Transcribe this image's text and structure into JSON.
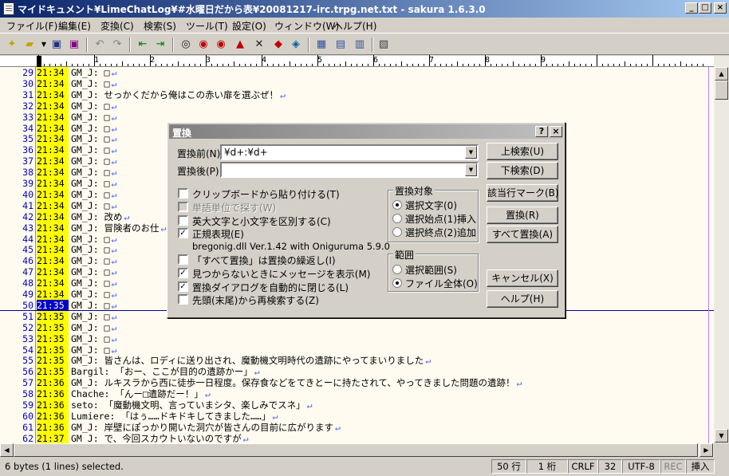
{
  "window": {
    "title": "マイドキュメント¥LimeChatLog¥#水曜日だから表¥20081217-irc.trpg.net.txt - sakura 1.6.3.0"
  },
  "menu": [
    "ファイル(F)",
    "編集(E)",
    "変換(C)",
    "検索(S)",
    "ツール(T)",
    "設定(O)",
    "ウィンドウ(W)",
    "ヘルプ(H)"
  ],
  "ruler": {
    "marks": [
      "1",
      "2",
      "3",
      "4",
      "5",
      "6",
      "7",
      "8",
      "9"
    ]
  },
  "editor": {
    "lines": [
      {
        "n": "29",
        "t": "21:34",
        "s": "GM_J: □"
      },
      {
        "n": "30",
        "t": "21:34",
        "s": "GM_J: □"
      },
      {
        "n": "31",
        "t": "21:34",
        "s": "GM_J: せっかくだから俺はこの赤い扉を選ぶぜ！"
      },
      {
        "n": "32",
        "t": "21:34",
        "s": "GM_J: □"
      },
      {
        "n": "33",
        "t": "21:34",
        "s": "GM_J: □"
      },
      {
        "n": "34",
        "t": "21:34",
        "s": "GM_J: □"
      },
      {
        "n": "35",
        "t": "21:34",
        "s": "GM_J: □"
      },
      {
        "n": "36",
        "t": "21:34",
        "s": "GM_J: □"
      },
      {
        "n": "37",
        "t": "21:34",
        "s": "GM_J: □"
      },
      {
        "n": "38",
        "t": "21:34",
        "s": "GM_J: □"
      },
      {
        "n": "39",
        "t": "21:34",
        "s": "GM_J: □"
      },
      {
        "n": "40",
        "t": "21:34",
        "s": "GM_J: □"
      },
      {
        "n": "41",
        "t": "21:34",
        "s": "GM_J: □"
      },
      {
        "n": "42",
        "t": "21:34",
        "s": "GM_J: 改め"
      },
      {
        "n": "43",
        "t": "21:34",
        "s": "GM_J: 冒険者のお仕"
      },
      {
        "n": "44",
        "t": "21:34",
        "s": "GM_J: □"
      },
      {
        "n": "45",
        "t": "21:34",
        "s": "GM_J: □"
      },
      {
        "n": "46",
        "t": "21:34",
        "s": "GM_J: □"
      },
      {
        "n": "47",
        "t": "21:34",
        "s": "GM_J: □"
      },
      {
        "n": "48",
        "t": "21:34",
        "s": "GM_J: □"
      },
      {
        "n": "49",
        "t": "21:34",
        "s": "GM_J: □"
      },
      {
        "n": "50",
        "t": "21:35",
        "s": "GM_J: □"
      },
      {
        "n": "51",
        "t": "21:35",
        "s": "GM_J: □"
      },
      {
        "n": "52",
        "t": "21:35",
        "s": "GM_J: □"
      },
      {
        "n": "53",
        "t": "21:35",
        "s": "GM_J: □"
      },
      {
        "n": "54",
        "t": "21:35",
        "s": "GM_J: □"
      },
      {
        "n": "55",
        "t": "21:35",
        "s": "GM_J: 皆さんは、ロディに送り出され、魔動機文明時代の遺跡にやってまいりました"
      },
      {
        "n": "56",
        "t": "21:35",
        "s": "Bargil: 「おー、ここが目的の遺跡かー」"
      },
      {
        "n": "57",
        "t": "21:36",
        "s": "GM_J: ルキスラから西に徒歩一日程度。保存食などをてきとーに持たされて、やってきました問題の遺跡！"
      },
      {
        "n": "58",
        "t": "21:36",
        "s": "Chache: 「んー□遺跡だー！」"
      },
      {
        "n": "59",
        "t": "21:36",
        "s": "seto: 「魔動機文明、言っていまシタ、楽しみでスネ」"
      },
      {
        "n": "60",
        "t": "21:36",
        "s": "Lumiere: 「はぅ……ドキドキしてきました……」"
      },
      {
        "n": "61",
        "t": "21:36",
        "s": "GM_J: 岸壁にぽっかり開いた洞穴が皆さんの目前に広がります"
      },
      {
        "n": "62",
        "t": "21:37",
        "s": "GM_J: で、今回スカウトいないのですが"
      }
    ],
    "current_line": "50",
    "return_mark": "↵"
  },
  "dialog": {
    "title": "置換",
    "find_label": "置換前(N)",
    "find_value": "¥d+:¥d+",
    "replace_label": "置換後(P)",
    "replace_value": "",
    "options": [
      {
        "label": "クリップボードから貼り付ける(T)",
        "checked": false,
        "disabled": false
      },
      {
        "label": "単語単位で探す(W)",
        "checked": false,
        "disabled": true
      },
      {
        "label": "英大文字と小文字を区別する(C)",
        "checked": false,
        "disabled": false
      },
      {
        "label": "正規表現(E)",
        "checked": true,
        "disabled": false
      }
    ],
    "regex_lib": "bregonig.dll Ver.1.42 with Oniguruma 5.9.0",
    "options2": [
      {
        "label": "「すべて置換」は置換の繰返し(I)",
        "checked": false
      },
      {
        "label": "見つからないときにメッセージを表示(M)",
        "checked": true
      },
      {
        "label": "置換ダイアログを自動的に閉じる(L)",
        "checked": true
      },
      {
        "label": "先頭(末尾)から再検索する(Z)",
        "checked": false
      }
    ],
    "target_group": {
      "title": "置換対象",
      "items": [
        {
          "label": "選択文字(0)",
          "selected": true
        },
        {
          "label": "選択始点(1)挿入",
          "selected": false
        },
        {
          "label": "選択終点(2)追加",
          "selected": false
        }
      ]
    },
    "range_group": {
      "title": "範囲",
      "items": [
        {
          "label": "選択範囲(S)",
          "selected": false
        },
        {
          "label": "ファイル全体(O)",
          "selected": true
        }
      ]
    },
    "buttons": {
      "find_up": "上検索(U)",
      "find_down": "下検索(D)",
      "mark": "該当行マーク(B)",
      "replace": "置換(R)",
      "replace_all": "すべて置換(A)",
      "cancel": "キャンセル(X)",
      "help": "ヘルプ(H)"
    }
  },
  "status": {
    "text": "6 bytes (1 lines) selected.",
    "row": "50 行",
    "col": "1 桁",
    "eol": "CRLF",
    "code": "32",
    "enc": "UTF-8",
    "rec": "REC",
    "mode": "挿入"
  }
}
